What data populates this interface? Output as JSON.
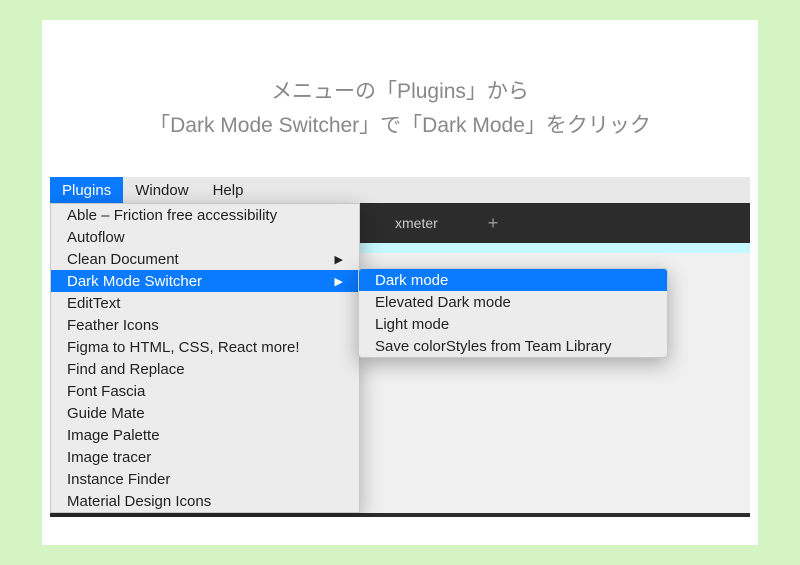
{
  "caption": {
    "line1": "メニューの「Plugins」から",
    "line2": "「Dark Mode Switcher」で「Dark Mode」をクリック"
  },
  "menubar": {
    "items": [
      "Plugins",
      "Window",
      "Help"
    ],
    "active_index": 0
  },
  "dark_header": {
    "tab_label": "xmeter"
  },
  "dropdown": {
    "items": [
      {
        "label": "Able – Friction free accessibility",
        "has_submenu": false
      },
      {
        "label": "Autoflow",
        "has_submenu": false
      },
      {
        "label": "Clean Document",
        "has_submenu": true
      },
      {
        "label": "Dark Mode Switcher",
        "has_submenu": true,
        "highlighted": true
      },
      {
        "label": "EditText",
        "has_submenu": false
      },
      {
        "label": "Feather Icons",
        "has_submenu": false
      },
      {
        "label": "Figma to HTML, CSS, React  more!",
        "has_submenu": false
      },
      {
        "label": "Find and Replace",
        "has_submenu": false
      },
      {
        "label": "Font Fascia",
        "has_submenu": false
      },
      {
        "label": "Guide Mate",
        "has_submenu": false
      },
      {
        "label": "Image Palette",
        "has_submenu": false
      },
      {
        "label": "Image tracer",
        "has_submenu": false
      },
      {
        "label": "Instance Finder",
        "has_submenu": false
      },
      {
        "label": "Material Design Icons",
        "has_submenu": false
      }
    ]
  },
  "submenu": {
    "items": [
      {
        "label": "Dark mode",
        "highlighted": true
      },
      {
        "label": "Elevated Dark mode"
      },
      {
        "label": "Light mode"
      },
      {
        "label": "Save colorStyles from Team Library"
      }
    ]
  }
}
